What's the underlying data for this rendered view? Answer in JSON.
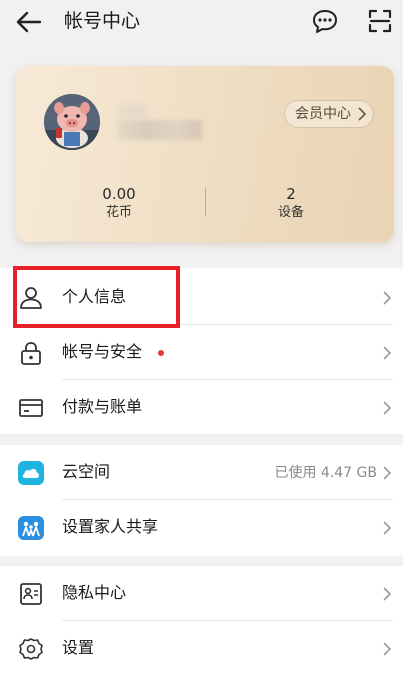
{
  "header": {
    "title": "帐号中心",
    "back_icon": "arrow-left-icon",
    "chat_icon": "chat-bubble-icon",
    "scan_icon": "scan-icon"
  },
  "profile": {
    "member_label": "会员中心",
    "stats": [
      {
        "value": "0.00",
        "label": "花币"
      },
      {
        "value": "2",
        "label": "设备"
      }
    ]
  },
  "menu": {
    "personal_info": {
      "label": "个人信息",
      "icon": "person-icon"
    },
    "security": {
      "label": "帐号与安全",
      "icon": "lock-icon"
    },
    "payment": {
      "label": "付款与账单",
      "icon": "card-icon"
    },
    "cloud": {
      "label": "云空间",
      "value": "已使用 4.47 GB",
      "icon": "cloud-icon"
    },
    "family": {
      "label": "设置家人共享",
      "icon": "family-icon"
    },
    "privacy": {
      "label": "隐私中心",
      "icon": "privacy-icon"
    },
    "settings": {
      "label": "设置",
      "icon": "gear-icon"
    }
  },
  "colors": {
    "accent_red": "#e8202a",
    "cloud_blue": "#1fb4e0",
    "family_blue": "#2a8fe0",
    "card_gold": "#efddc2"
  }
}
